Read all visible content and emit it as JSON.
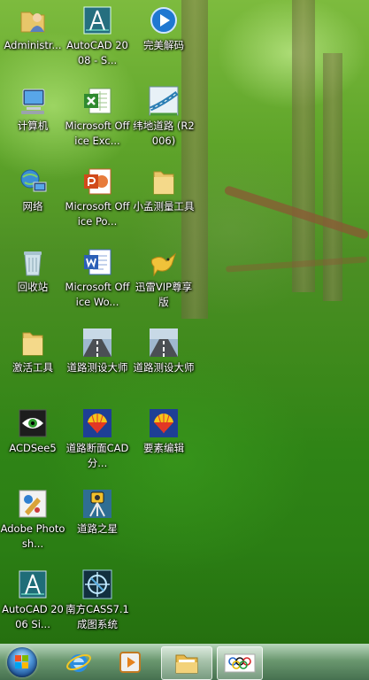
{
  "desktop": {
    "icons": [
      {
        "label": "Administr...",
        "icon": "user-folder-icon"
      },
      {
        "label": "AutoCAD 2008 - S...",
        "icon": "autocad-icon"
      },
      {
        "label": "完美解码",
        "icon": "media-player-icon"
      },
      {
        "label": "计算机",
        "icon": "computer-icon"
      },
      {
        "label": "Microsoft Office Exc...",
        "icon": "excel-icon"
      },
      {
        "label": "纬地道路 (R2006)",
        "icon": "road-design-icon"
      },
      {
        "label": "网络",
        "icon": "network-icon"
      },
      {
        "label": "Microsoft Office Po...",
        "icon": "powerpoint-icon"
      },
      {
        "label": "小孟测量工具",
        "icon": "folder-icon"
      },
      {
        "label": "回收站",
        "icon": "recycle-bin-icon"
      },
      {
        "label": "Microsoft Office Wo...",
        "icon": "word-icon"
      },
      {
        "label": "迅雷VIP尊享版",
        "icon": "thunder-icon"
      },
      {
        "label": "激活工具",
        "icon": "folder-icon"
      },
      {
        "label": "道路测设大师",
        "icon": "road-icon"
      },
      {
        "label": "道路测设大师",
        "icon": "road-icon"
      },
      {
        "label": "ACDSee5",
        "icon": "acdsee-icon"
      },
      {
        "label": "道路断面CAD分...",
        "icon": "shell-app-icon"
      },
      {
        "label": "要素编辑",
        "icon": "shell-app-icon"
      },
      {
        "label": "Adobe Photosh...",
        "icon": "photoshop-icon"
      },
      {
        "label": "道路之星",
        "icon": "survey-instrument-icon"
      },
      {
        "label": "AutoCAD 2006 Si...",
        "icon": "autocad-icon"
      },
      {
        "label": "南方CASS7.1成图系统",
        "icon": "cass-icon"
      }
    ]
  },
  "taskbar": {
    "items": [
      {
        "name": "start-button",
        "icon": "windows-orb-icon"
      },
      {
        "name": "internet-explorer",
        "icon": "ie-icon"
      },
      {
        "name": "media-player",
        "icon": "media-player-icon"
      },
      {
        "name": "windows-explorer",
        "icon": "folder-icon"
      },
      {
        "name": "olympic-app",
        "icon": "rings-icon"
      }
    ]
  },
  "colors": {
    "taskbar": "#5b8f60",
    "label_text": "#ffffff"
  }
}
